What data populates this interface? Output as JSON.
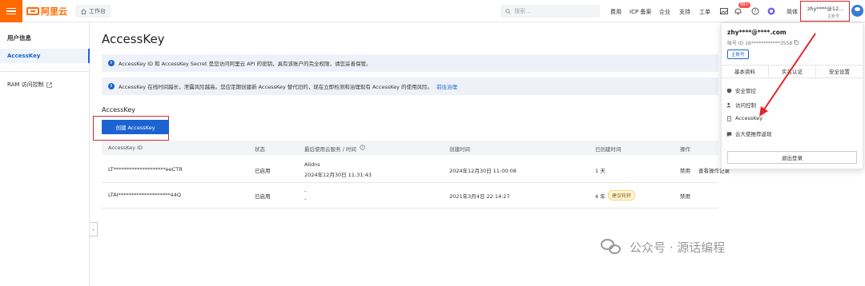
{
  "topbar": {
    "logo_text": "阿里云",
    "workbench": "工作台",
    "search_placeholder": "搜索...",
    "nav": [
      "费用",
      "ICP 备案",
      "企业",
      "支持",
      "工单"
    ],
    "badge": "99+",
    "lang": "简体",
    "user_display": "zhy****@12...",
    "user_role": "主账号"
  },
  "sidebar": {
    "title": "用户信息",
    "active_item": "AccessKey",
    "ram_link": "RAM 访问控制"
  },
  "main": {
    "page_title": "AccessKey",
    "notice1": "AccessKey ID 和 AccessKey Secret 是您访问阿里云 API 的密钥，具有该账户的完全权限，请您妥善保管。",
    "notice2": "AccessKey 在线时间越长，泄露风险越高。您应定期创建新 AccessKey 替代旧的，现在立即检测和治理现有 AccessKey 的使用风险。",
    "notice2_link": "前往治理",
    "section_title": "AccessKey",
    "create_button": "创建 AccessKey",
    "table": {
      "headers": [
        "AccessKey ID",
        "状态",
        "最后使用云服务 / 时间",
        "创建时间",
        "已创建时间",
        "操作"
      ],
      "rows": [
        {
          "id": "LT********************eeCTR",
          "status": "已启用",
          "service": "Alidns",
          "last_used": "2024年12月30日 11:31:43",
          "created": "2024年12月30日 11:00:08",
          "age": "1 天",
          "tag": "",
          "action1": "禁用",
          "action2": "查看操作记录"
        },
        {
          "id": "LTAI********************44Q",
          "status": "已启用",
          "service": "-",
          "last_used": "-",
          "created": "2021年3月4日 22:14:27",
          "age": "4 年",
          "tag": "建议轮转",
          "action1": "禁用",
          "action2": ""
        }
      ]
    }
  },
  "panel": {
    "name": "zhy****@****.com",
    "id_label": "账号 ID",
    "id_value": "16************3558",
    "role_tag": "主账号",
    "tabs": [
      "基本资料",
      "实名认证",
      "安全设置"
    ],
    "items": [
      "安全管控",
      "访问控制",
      "AccessKey",
      "云大使推荐返现"
    ],
    "logout": "退出登录"
  },
  "watermark": "公众号 · 源话编程",
  "colors": {
    "brand": "#ff6a00",
    "primary": "#1c62d0",
    "highlight": "#e0262b"
  }
}
